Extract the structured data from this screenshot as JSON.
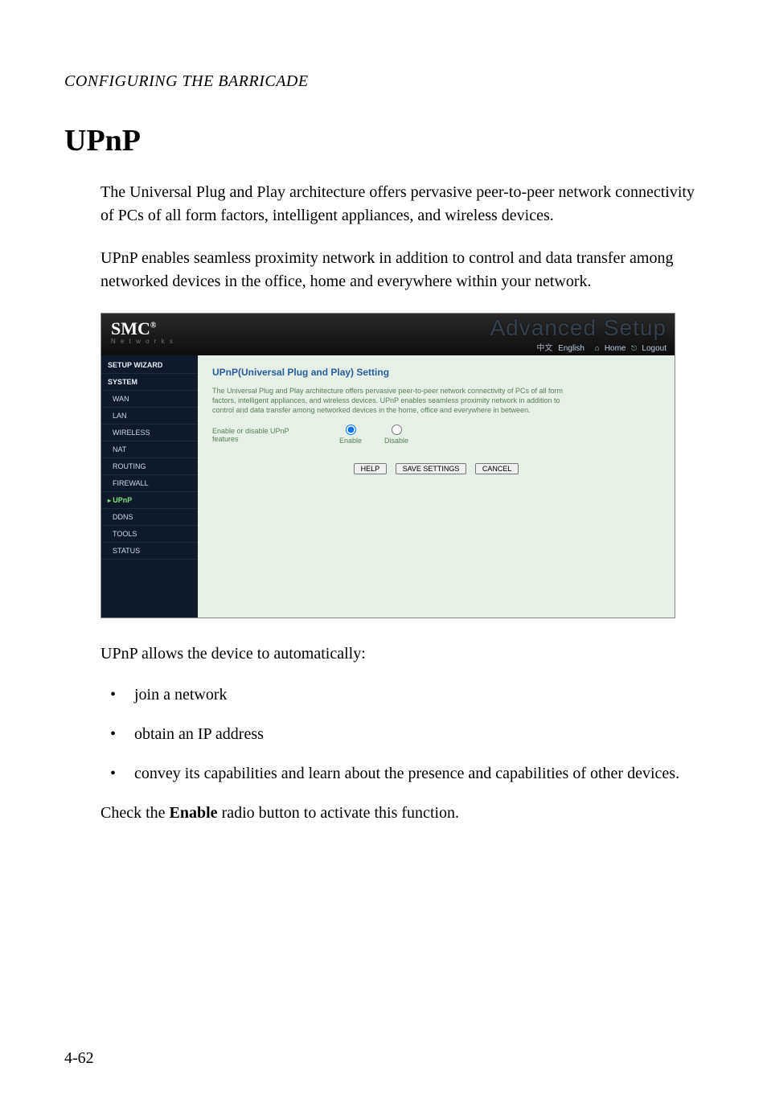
{
  "running_head": "CONFIGURING THE BARRICADE",
  "title": "UPnP",
  "para1": "The Universal Plug and Play architecture offers pervasive peer-to-peer network connectivity of PCs of all form factors, intelligent appliances, and wireless devices.",
  "para2": "UPnP enables seamless proximity network in addition to control and data transfer among networked devices in the office, home and everywhere within your network.",
  "screenshot": {
    "logo_main": "SMC",
    "logo_reg": "®",
    "logo_sub": "N e t w o r k s",
    "brand_fade": "Advanced Setup",
    "topnav": {
      "lang1": "中文",
      "lang2": "English",
      "home": "Home",
      "logout": "Logout"
    },
    "sidebar": [
      "SETUP WIZARD",
      "SYSTEM",
      "WAN",
      "LAN",
      "WIRELESS",
      "NAT",
      "ROUTING",
      "FIREWALL",
      "UPnP",
      "DDNS",
      "TOOLS",
      "STATUS"
    ],
    "sidebar_active_index": 8,
    "panel": {
      "heading": "UPnP(Universal Plug and Play) Setting",
      "desc": "The Universal Plug and Play architecture offers pervasive peer-to-peer network connectivity of PCs of all form factors, intelligent appliances, and wireless devices. UPnP enables seamless proximity network in addition to control and data transfer among networked devices in the home, office and everywhere in between.",
      "row_label": "Enable or disable UPnP features",
      "opt_enable": "Enable",
      "opt_disable": "Disable",
      "btn_help": "HELP",
      "btn_save": "SAVE SETTINGS",
      "btn_cancel": "CANCEL"
    }
  },
  "post_img": "UPnP allows the device to automatically:",
  "bullets": [
    "join a network",
    "obtain an IP address",
    "convey its capabilities and learn about the presence and capabilities of other devices."
  ],
  "enable_note_pre": "Check the ",
  "enable_note_bold": "Enable",
  "enable_note_post": " radio button to activate this function.",
  "page_number": "4-62"
}
